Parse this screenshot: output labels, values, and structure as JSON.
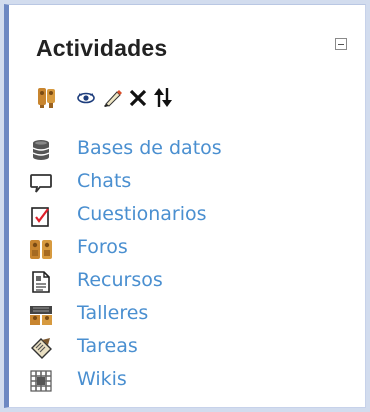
{
  "block": {
    "title": "Actividades",
    "collapse_icon": "minus-box-icon"
  },
  "toolbar": [
    {
      "name": "participants-icon"
    },
    {
      "name": "eye-icon"
    },
    {
      "name": "edit-icon"
    },
    {
      "name": "delete-icon"
    },
    {
      "name": "move-icon"
    }
  ],
  "activities": [
    {
      "label": "Bases de datos",
      "icon": "database-icon"
    },
    {
      "label": "Chats",
      "icon": "chat-icon"
    },
    {
      "label": "Cuestionarios",
      "icon": "quiz-icon"
    },
    {
      "label": "Foros",
      "icon": "forum-icon"
    },
    {
      "label": "Recursos",
      "icon": "resource-icon"
    },
    {
      "label": "Talleres",
      "icon": "workshop-icon"
    },
    {
      "label": "Tareas",
      "icon": "assignment-icon"
    },
    {
      "label": "Wikis",
      "icon": "wiki-icon"
    }
  ],
  "colors": {
    "link": "#4a8fd0",
    "border_accent": "#6d88c2",
    "frame": "#d2dcee"
  }
}
